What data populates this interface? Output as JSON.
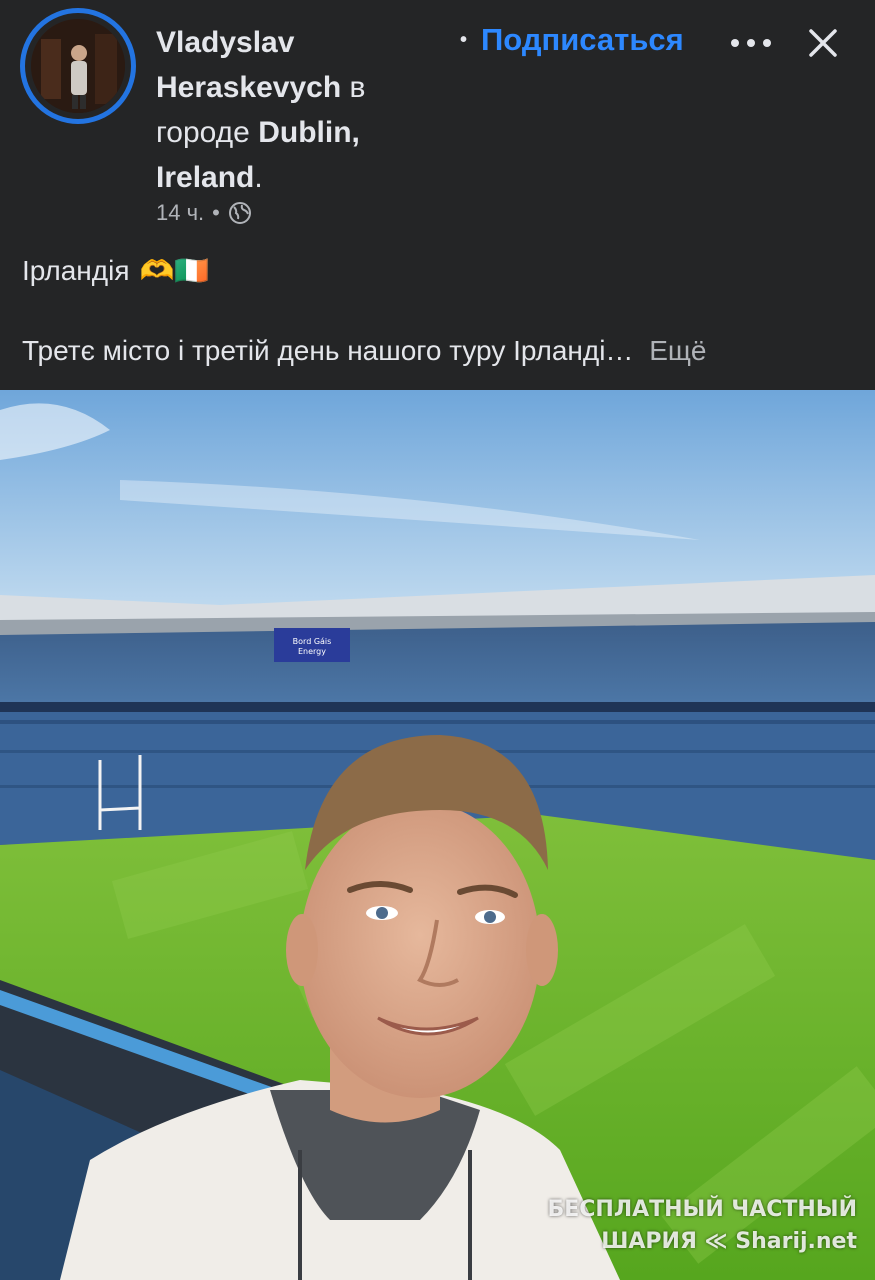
{
  "post": {
    "author_first": "Vladyslav",
    "author_last": "Heraskevych",
    "location_prefix": "в",
    "location_word": "городе",
    "city": "Dublin,",
    "country": "Ireland",
    "country_suffix": ".",
    "time": "14 ч.",
    "dot": "•",
    "privacy_icon": "globe-icon",
    "subscribe_label": "Подписаться",
    "title": "Ірландія",
    "title_emoji": "🫶🇮🇪",
    "body": "Третє місто і третій день нашого туру Ірланді…",
    "more_label": "Ещё"
  },
  "photo": {
    "stadium_board_line1": "Bord Gáis",
    "stadium_board_line2": "Energy"
  },
  "watermark": {
    "line1": "БЕСПЛАТНЫЙ ЧАСТНЫЙ",
    "line2": "ШАРИЯ ≪ Sharij.net"
  },
  "colors": {
    "background": "#242526",
    "accent": "#2374e1",
    "link": "#2d88ff"
  }
}
